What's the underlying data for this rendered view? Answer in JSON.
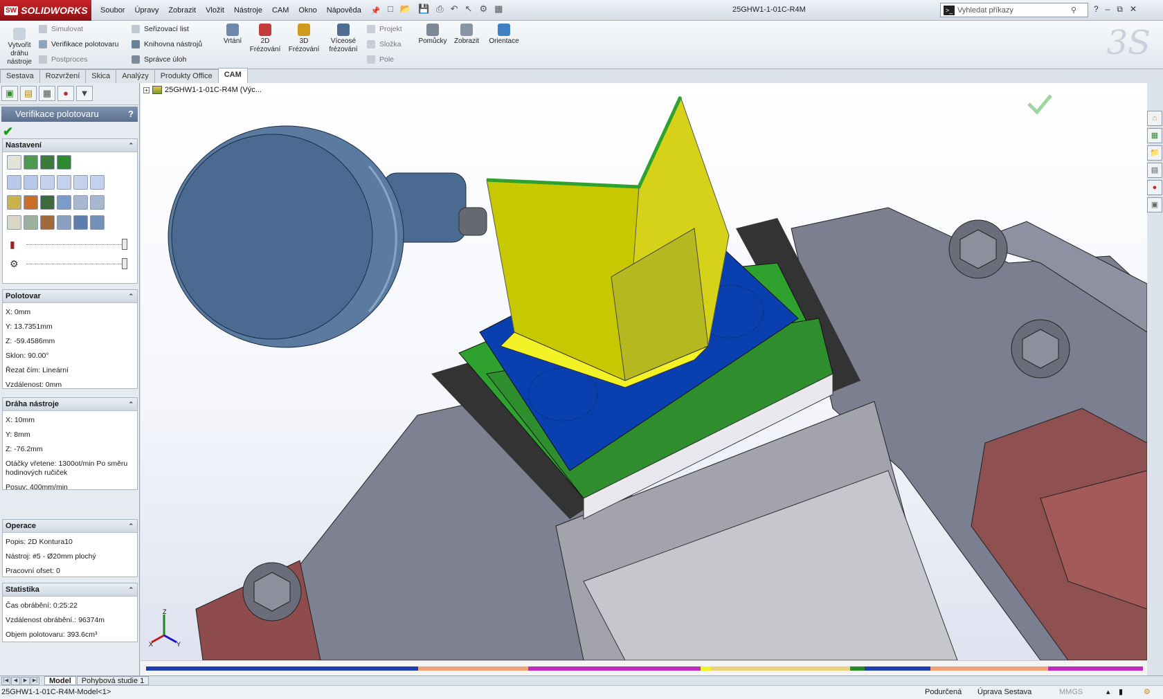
{
  "app": {
    "logo_prefix": "SW",
    "logo_name": "SOLIDWORKS",
    "document_title": "25GHW1-1-01C-R4M"
  },
  "menu": [
    "Soubor",
    "Úpravy",
    "Zobrazit",
    "Vložit",
    "Nástroje",
    "CAM",
    "Okno",
    "Nápověda"
  ],
  "search": {
    "placeholder": "Vyhledat příkazy"
  },
  "toolbar": {
    "create_toolpath": "Vytvořit dráhu nástroje",
    "simulate": "Simulovat",
    "stock_verification": "Verifikace polotovaru",
    "postprocess": "Postproces",
    "setup_sheet": "Seřizovací list",
    "tool_library": "Knihovna nástrojů",
    "job_manager": "Správce úloh",
    "drilling": "Vrtání",
    "milling_2d": "2D Frézování",
    "milling_3d": "3D Frézování",
    "multiaxis": "Víceosé frézování",
    "project": "Projekt",
    "folder": "Složka",
    "pattern": "Pole",
    "utilities": "Pomůcky",
    "display": "Zobrazit",
    "orientation": "Orientace"
  },
  "tabs": [
    {
      "label": "Sestava",
      "active": false
    },
    {
      "label": "Rozvržení",
      "active": false
    },
    {
      "label": "Skica",
      "active": false
    },
    {
      "label": "Analýzy",
      "active": false
    },
    {
      "label": "Produkty Office",
      "active": false
    },
    {
      "label": "CAM",
      "active": true
    }
  ],
  "panel": {
    "title": "Verifikace polotovaru",
    "help": "?",
    "settings": {
      "title": "Nastavení"
    },
    "stock": {
      "title": "Polotovar",
      "x": "X: 0mm",
      "y": "Y: 13.7351mm",
      "z": "Z: -59.4586mm",
      "tilt": "Sklon: 90.00°",
      "cut_by": "Řezat čím: Lineární",
      "distance": "Vzdálenost: 0mm"
    },
    "toolpath": {
      "title": "Dráha nástroje",
      "x": "X: 10mm",
      "y": "Y: 8mm",
      "z": "Z: -76.2mm",
      "spindle": "Otáčky vřetene: 1300ot/min Po směru hodinových ručiček",
      "feed": "Posuv: 400mm/min"
    },
    "operation": {
      "title": "Operace",
      "desc": "Popis: 2D Kontura10",
      "tool": "Nástroj: #5 - Ø20mm plochý",
      "offset": "Pracovní ofset: 0"
    },
    "stats": {
      "title": "Statistika",
      "time": "Čas obrábění: 0:25:22",
      "dist": "Vzdálenost obrábění.: 96374m",
      "volume": "Objem polotovaru: 393.6cm³"
    }
  },
  "tree": {
    "root": "25GHW1-1-01C-R4M  (Výc..."
  },
  "triad": {
    "x": "X",
    "y": "Y",
    "z": "Z"
  },
  "bottom_tabs": [
    {
      "label": "Model",
      "active": true
    },
    {
      "label": "Pohybová studie 1",
      "active": false
    }
  ],
  "status": {
    "left": "25GHW1-1-01C-R4M-Model<1>",
    "state": "Podurčená",
    "mode": "Úprava Sestava",
    "units": "MMGS"
  },
  "colors": {
    "accent": "#5b7090",
    "stock_yellow": "#c8c800",
    "part_blue": "#0a3fb0",
    "fixture_green": "#2ea12e",
    "vise_gray": "#7c7f8f",
    "spindle": "#5a7aa0"
  }
}
